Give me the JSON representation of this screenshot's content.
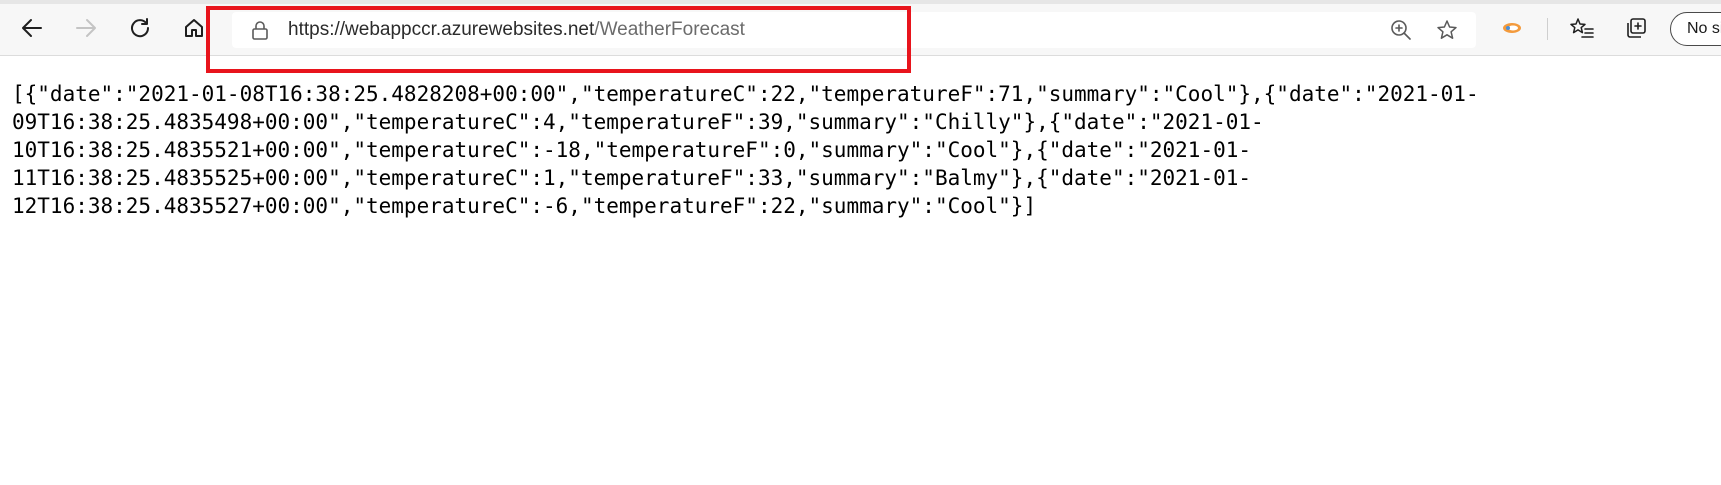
{
  "browser": {
    "address_bar": {
      "url_scheme_host": "https://webappccr.azurewebsites.net",
      "url_path": "/WeatherForecast"
    },
    "profile_button_label": "No si",
    "icons": {
      "back": "back-arrow-icon",
      "forward": "forward-arrow-icon",
      "refresh": "refresh-icon",
      "home": "home-icon",
      "lock": "lock-icon",
      "zoom": "zoom-in-icon",
      "favorite": "star-icon",
      "extension": "extension-icon",
      "favorites_list": "favorites-icon",
      "collections": "collections-icon"
    },
    "highlight_color": "#e8141c"
  },
  "page": {
    "json_lines": [
      "[{\"date\":\"2021-01-08T16:38:25.4828208+00:00\",\"temperatureC\":22,\"temperatureF\":71,\"summary\":\"Cool\"},{\"date\":\"2021-01-",
      "09T16:38:25.4835498+00:00\",\"temperatureC\":4,\"temperatureF\":39,\"summary\":\"Chilly\"},{\"date\":\"2021-01-",
      "10T16:38:25.4835521+00:00\",\"temperatureC\":-18,\"temperatureF\":0,\"summary\":\"Cool\"},{\"date\":\"2021-01-",
      "11T16:38:25.4835525+00:00\",\"temperatureC\":1,\"temperatureF\":33,\"summary\":\"Balmy\"},{\"date\":\"2021-01-",
      "12T16:38:25.4835527+00:00\",\"temperatureC\":-6,\"temperatureF\":22,\"summary\":\"Cool\"}]"
    ]
  }
}
